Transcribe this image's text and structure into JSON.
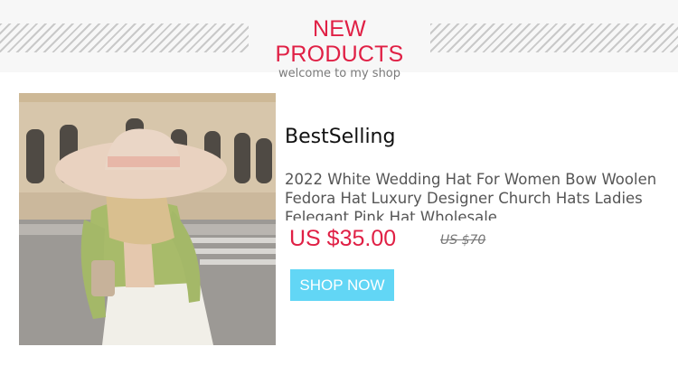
{
  "header": {
    "title": "NEW PRODUCTS",
    "subtitle": "welcome to my shop",
    "accent_color": "#e02045"
  },
  "product": {
    "badge": "BestSelling",
    "description": "2022 White Wedding Hat For Women Bow Woolen Fedora Hat Luxury Designer Church Hats Ladies Felegant Pink Hat Wholesale",
    "price": "US $35.00",
    "old_price": "US $70",
    "button_label": "SHOP NOW",
    "button_color": "#62d6f5"
  }
}
